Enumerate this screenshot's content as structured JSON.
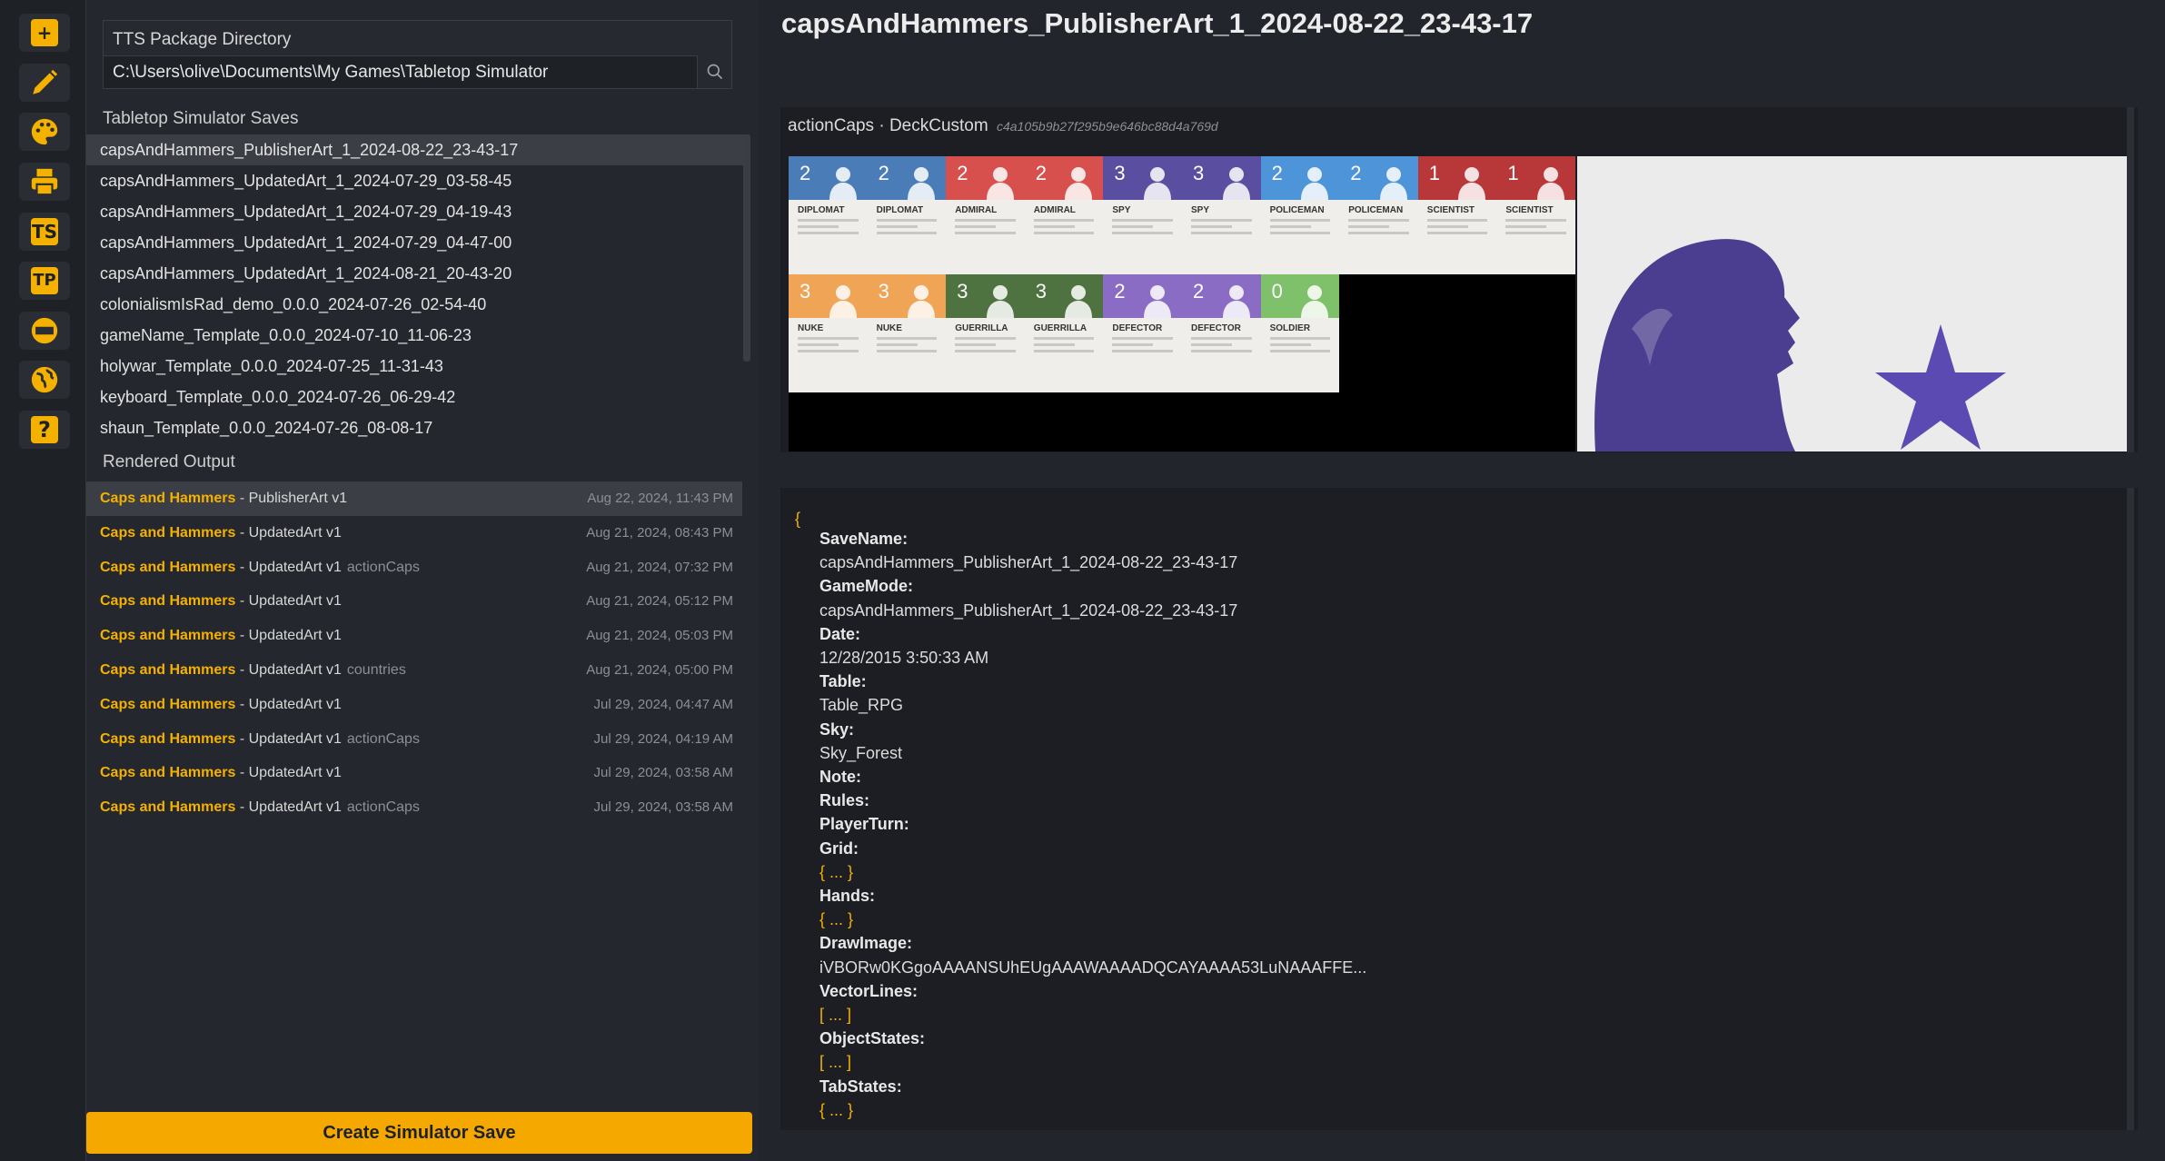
{
  "sidebar": {
    "icons": [
      "plus-icon",
      "pencil-icon",
      "palette-icon",
      "printer-icon",
      "tts-icon",
      "tp-icon",
      "game-crafter-icon",
      "globe-icon",
      "help-icon"
    ],
    "tts_label": "TS",
    "tp_label": "TP",
    "help_label": "?",
    "plus_label": "+"
  },
  "directory": {
    "label": "TTS Package Directory",
    "value": "C:\\Users\\olive\\Documents\\My Games\\Tabletop Simulator"
  },
  "saves": {
    "title": "Tabletop Simulator Saves",
    "items": [
      "capsAndHammers_PublisherArt_1_2024-08-22_23-43-17",
      "capsAndHammers_UpdatedArt_1_2024-07-29_03-58-45",
      "capsAndHammers_UpdatedArt_1_2024-07-29_04-19-43",
      "capsAndHammers_UpdatedArt_1_2024-07-29_04-47-00",
      "capsAndHammers_UpdatedArt_1_2024-08-21_20-43-20",
      "colonialismIsRad_demo_0.0.0_2024-07-26_02-54-40",
      "gameName_Template_0.0.0_2024-07-10_11-06-23",
      "holywar_Template_0.0.0_2024-07-25_11-31-43",
      "keyboard_Template_0.0.0_2024-07-26_06-29-42",
      "shaun_Template_0.0.0_2024-07-26_08-08-17"
    ]
  },
  "outputs": {
    "title": "Rendered Output",
    "separator": " - ",
    "items": [
      {
        "project": "Caps and Hammers",
        "version": "PublisherArt v1",
        "tag": "",
        "date": "Aug 22, 2024, 11:43 PM"
      },
      {
        "project": "Caps and Hammers",
        "version": "UpdatedArt v1",
        "tag": "",
        "date": "Aug 21, 2024, 08:43 PM"
      },
      {
        "project": "Caps and Hammers",
        "version": "UpdatedArt v1",
        "tag": "actionCaps",
        "date": "Aug 21, 2024, 07:32 PM"
      },
      {
        "project": "Caps and Hammers",
        "version": "UpdatedArt v1",
        "tag": "",
        "date": "Aug 21, 2024, 05:12 PM"
      },
      {
        "project": "Caps and Hammers",
        "version": "UpdatedArt v1",
        "tag": "",
        "date": "Aug 21, 2024, 05:03 PM"
      },
      {
        "project": "Caps and Hammers",
        "version": "UpdatedArt v1",
        "tag": "countries",
        "date": "Aug 21, 2024, 05:00 PM"
      },
      {
        "project": "Caps and Hammers",
        "version": "UpdatedArt v1",
        "tag": "",
        "date": "Jul 29, 2024, 04:47 AM"
      },
      {
        "project": "Caps and Hammers",
        "version": "UpdatedArt v1",
        "tag": "actionCaps",
        "date": "Jul 29, 2024, 04:19 AM"
      },
      {
        "project": "Caps and Hammers",
        "version": "UpdatedArt v1",
        "tag": "",
        "date": "Jul 29, 2024, 03:58 AM"
      },
      {
        "project": "Caps and Hammers",
        "version": "UpdatedArt v1",
        "tag": "actionCaps",
        "date": "Jul 29, 2024, 03:58 AM"
      }
    ]
  },
  "create_button": "Create Simulator Save",
  "main": {
    "title": "capsAndHammers_PublisherArt_1_2024-08-22_23-43-17",
    "preview": {
      "name": "actionCaps · DeckCustom",
      "hash": "c4a105b9b27f295b9e646bc88d4a769d"
    },
    "cards": [
      {
        "num": "2",
        "name": "DIPLOMAT",
        "color": "#4a7db8"
      },
      {
        "num": "2",
        "name": "DIPLOMAT",
        "color": "#4a7db8"
      },
      {
        "num": "2",
        "name": "ADMIRAL",
        "color": "#d8504e"
      },
      {
        "num": "2",
        "name": "ADMIRAL",
        "color": "#d8504e"
      },
      {
        "num": "3",
        "name": "SPY",
        "color": "#5a4ea0"
      },
      {
        "num": "3",
        "name": "SPY",
        "color": "#5a4ea0"
      },
      {
        "num": "2",
        "name": "POLICEMAN",
        "color": "#4e94d8"
      },
      {
        "num": "2",
        "name": "POLICEMAN",
        "color": "#4e94d8"
      },
      {
        "num": "1",
        "name": "SCIENTIST",
        "color": "#b8383a"
      },
      {
        "num": "1",
        "name": "SCIENTIST",
        "color": "#b8383a"
      },
      {
        "num": "3",
        "name": "NUKE",
        "color": "#f0a456"
      },
      {
        "num": "3",
        "name": "NUKE",
        "color": "#f0a456"
      },
      {
        "num": "3",
        "name": "GUERRILLA",
        "color": "#4f7340"
      },
      {
        "num": "3",
        "name": "GUERRILLA",
        "color": "#4f7340"
      },
      {
        "num": "2",
        "name": "DEFECTOR",
        "color": "#8a6cc4"
      },
      {
        "num": "2",
        "name": "DEFECTOR",
        "color": "#8a6cc4"
      },
      {
        "num": "0",
        "name": "SOLDIER",
        "color": "#7fc06a"
      }
    ],
    "json": {
      "open": "{",
      "fields": [
        {
          "key": "SaveName:",
          "value": "capsAndHammers_PublisherArt_1_2024-08-22_23-43-17"
        },
        {
          "key": "GameMode:",
          "value": "capsAndHammers_PublisherArt_1_2024-08-22_23-43-17"
        },
        {
          "key": "Date:",
          "value": "12/28/2015 3:50:33 AM"
        },
        {
          "key": "Table:",
          "value": "Table_RPG"
        },
        {
          "key": "Sky:",
          "value": "Sky_Forest"
        },
        {
          "key": "Note:",
          "value": ""
        },
        {
          "key": "Rules:",
          "value": ""
        },
        {
          "key": "PlayerTurn:",
          "value": ""
        },
        {
          "key": "Grid:",
          "value": "{ ... }"
        },
        {
          "key": "Hands:",
          "value": "{ ... }"
        },
        {
          "key": "DrawImage:",
          "value": "iVBORw0KGgoAAAANSUhEUgAAAWAAAADQCAYAAAA53LuNAAAFFE..."
        },
        {
          "key": "VectorLines:",
          "value": "[ ... ]"
        },
        {
          "key": "ObjectStates:",
          "value": "[ ... ]"
        },
        {
          "key": "TabStates:",
          "value": "{ ... }"
        }
      ]
    }
  }
}
